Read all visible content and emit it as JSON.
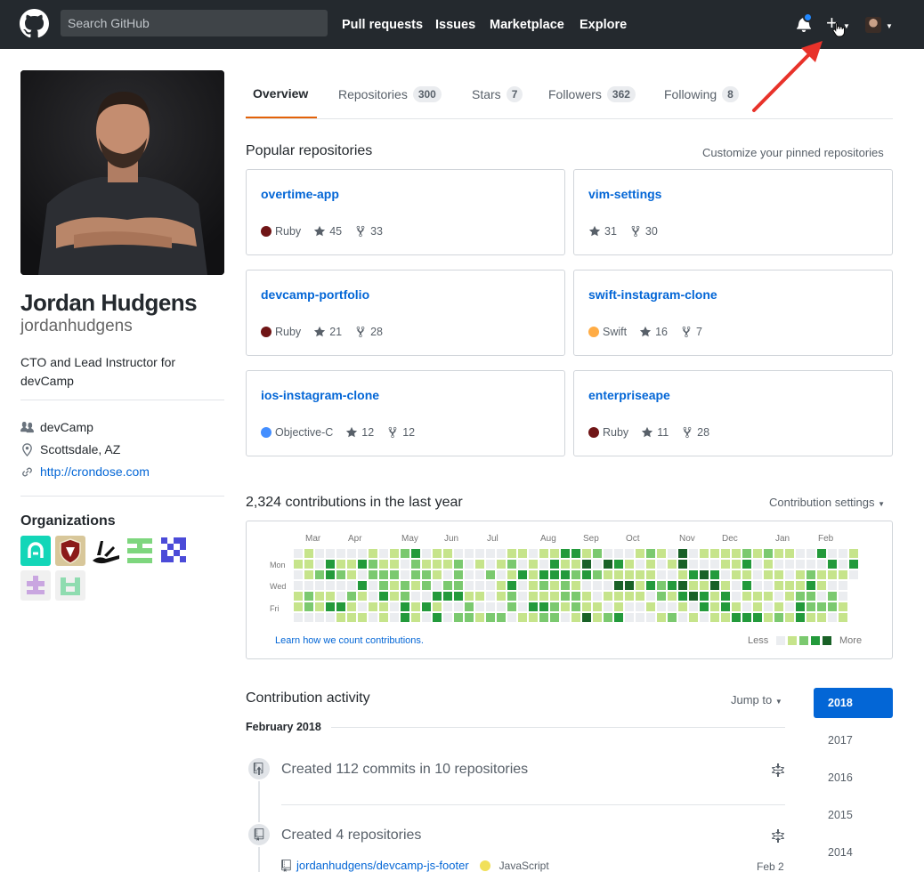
{
  "header": {
    "search_placeholder": "Search GitHub",
    "nav": [
      "Pull requests",
      "Issues",
      "Marketplace",
      "Explore"
    ]
  },
  "profile": {
    "full_name": "Jordan Hudgens",
    "username": "jordanhudgens",
    "bio": "CTO and Lead Instructor for devCamp",
    "company": "devCamp",
    "location": "Scottsdale, AZ",
    "website": "http://crondose.com",
    "organizations_title": "Organizations"
  },
  "tabs": [
    {
      "label": "Overview",
      "count": ""
    },
    {
      "label": "Repositories",
      "count": "300"
    },
    {
      "label": "Stars",
      "count": "7"
    },
    {
      "label": "Followers",
      "count": "362"
    },
    {
      "label": "Following",
      "count": "8"
    }
  ],
  "popular": {
    "title": "Popular repositories",
    "customize_link": "Customize your pinned repositories",
    "repos": [
      {
        "name": "overtime-app",
        "language": "Ruby",
        "language_color": "#701516",
        "stars": "45",
        "forks": "33"
      },
      {
        "name": "vim-settings",
        "language": "",
        "language_color": "",
        "stars": "31",
        "forks": "30"
      },
      {
        "name": "devcamp-portfolio",
        "language": "Ruby",
        "language_color": "#701516",
        "stars": "21",
        "forks": "28"
      },
      {
        "name": "swift-instagram-clone",
        "language": "Swift",
        "language_color": "#ffac45",
        "stars": "16",
        "forks": "7"
      },
      {
        "name": "ios-instagram-clone",
        "language": "Objective-C",
        "language_color": "#438eff",
        "stars": "12",
        "forks": "12"
      },
      {
        "name": "enterpriseape",
        "language": "Ruby",
        "language_color": "#701516",
        "stars": "11",
        "forks": "28"
      }
    ]
  },
  "contributions": {
    "title": "2,324 contributions in the last year",
    "settings_label": "Contribution settings",
    "months": [
      "Mar",
      "Apr",
      "May",
      "Jun",
      "Jul",
      "Aug",
      "Sep",
      "Oct",
      "Nov",
      "Dec",
      "Jan",
      "Feb"
    ],
    "day_labels": [
      "Mon",
      "Wed",
      "Fri"
    ],
    "learn_link": "Learn how we count contributions.",
    "legend_less": "Less",
    "legend_more": "More",
    "level_colors": [
      "#ebedf0",
      "#c6e48b",
      "#7bc96f",
      "#239a3b",
      "#196127"
    ]
  },
  "activity": {
    "title": "Contribution activity",
    "jump_to": "Jump to",
    "years": [
      "2018",
      "2017",
      "2016",
      "2015",
      "2014"
    ],
    "month_heading": "February 2018",
    "items": [
      {
        "title": "Created 112 commits in 10 repositories"
      },
      {
        "title": "Created 4 repositories"
      }
    ],
    "repo_entry": {
      "name": "jordanhudgens/devcamp-js-footer",
      "language": "JavaScript",
      "language_color": "#f1e05a",
      "date": "Feb 2"
    }
  }
}
